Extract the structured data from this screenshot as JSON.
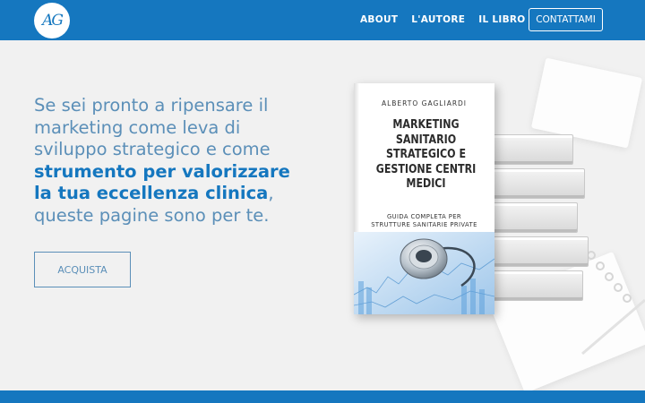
{
  "header": {
    "logo_text": "AG",
    "nav": [
      {
        "label": "ABOUT"
      },
      {
        "label": "L'AUTORE"
      },
      {
        "label": "IL LIBRO"
      }
    ],
    "cta_label": "CONTATTAMI"
  },
  "hero": {
    "line_1": "Se sei pronto a ripensare il",
    "line_2": "marketing come leva di",
    "line_3": "sviluppo strategico e come",
    "strong_1": "strumento per valorizzare",
    "strong_2": "la tua eccellenza clinica",
    "after_strong": ",",
    "line_last": "queste pagine sono per te.",
    "button_label": "ACQUISTA"
  },
  "book": {
    "author": "ALBERTO GAGLIARDI",
    "title_lines": [
      "MARKETING",
      "SANITARIO",
      "STRATEGICO E",
      "GESTIONE CENTRI",
      "MEDICI"
    ],
    "subtitle_lines": [
      "GUIDA COMPLETA PER",
      "STRUTTURE SANITARIE PRIVATE"
    ]
  },
  "colors": {
    "brand": "#1577bf",
    "hero_text": "#5b8fb8",
    "background": "#f1f1f1"
  },
  "icons": {
    "logo": "monogram-logo",
    "cover_image": "stethoscope-on-charts"
  }
}
